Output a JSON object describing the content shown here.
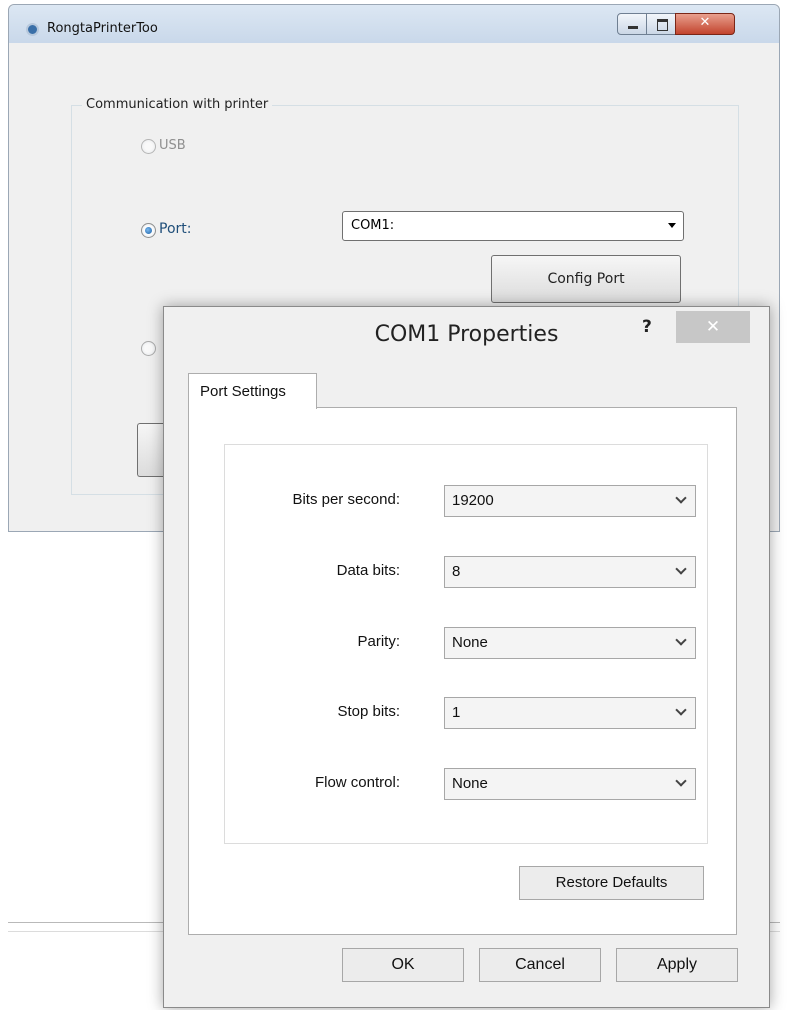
{
  "background_window": {
    "title": "RongtaPrinterToo",
    "group_title": "Communication with printer",
    "usb_label": "USB",
    "port_label": "Port:",
    "port_value": "COM1:",
    "config_port_button": "Config Port",
    "port_selected": true
  },
  "dialog": {
    "title": "COM1 Properties",
    "help_symbol": "?",
    "close_symbol": "✕",
    "tab": "Port Settings",
    "settings": [
      {
        "label": "Bits per second:",
        "value": "19200"
      },
      {
        "label": "Data bits:",
        "value": "8"
      },
      {
        "label": "Parity:",
        "value": "None"
      },
      {
        "label": "Stop bits:",
        "value": "1"
      },
      {
        "label": "Flow control:",
        "value": "None"
      }
    ],
    "restore_defaults": "Restore Defaults",
    "buttons": {
      "ok": "OK",
      "cancel": "Cancel",
      "apply": "Apply"
    }
  },
  "icons": [
    "app-icon",
    "minimize-icon",
    "maximize-icon",
    "close-icon",
    "help-icon",
    "chevron-down-icon"
  ]
}
